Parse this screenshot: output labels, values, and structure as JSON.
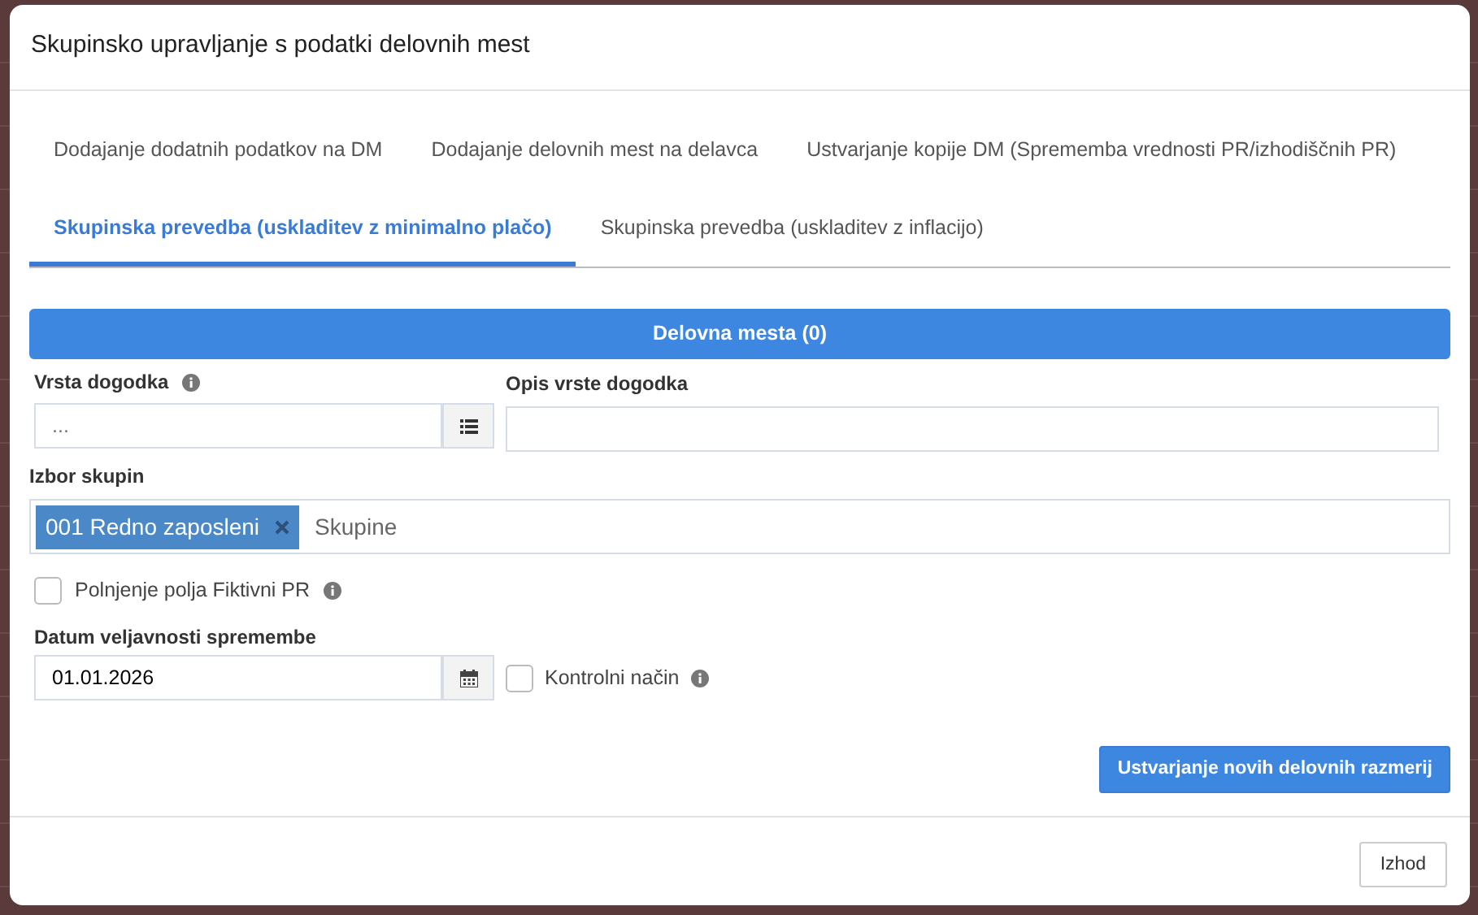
{
  "dialog": {
    "title": "Skupinsko upravljanje s podatki delovnih mest"
  },
  "tab_rows": [
    [
      {
        "label": "Dodajanje dodatnih podatkov na DM",
        "selected": false
      },
      {
        "label": "Dodajanje delovnih mest na delavca",
        "selected": false
      },
      {
        "label": "Ustvarjanje kopije DM (Sprememba vrednosti PR/izhodiščnih PR)",
        "selected": false
      }
    ],
    [
      {
        "label": "Skupinska prevedba (uskladitev z minimalno plačo)",
        "selected": true
      },
      {
        "label": "Skupinska prevedba (uskladitev z inflacijo)",
        "selected": false
      }
    ]
  ],
  "section_button": "Delovna mesta (0)",
  "event_type": {
    "label": "Vrsta dogodka",
    "placeholder": "..."
  },
  "event_description": {
    "label": "Opis vrste dogodka"
  },
  "group_select": {
    "label": "Izbor skupin",
    "tags": [
      {
        "label": "001 Redno zaposleni"
      }
    ],
    "placeholder": "Skupine"
  },
  "fictitious_checkbox": {
    "label": "Polnjenje polja Fiktivni PR",
    "checked": false
  },
  "date": {
    "label": "Datum veljavnosti spremembe",
    "value": "01.01.2026"
  },
  "control_mode": {
    "label": "Kontrolni način",
    "checked": false
  },
  "create_button": "Ustvarjanje novih delovnih razmerij",
  "exit_button": "Izhod"
}
